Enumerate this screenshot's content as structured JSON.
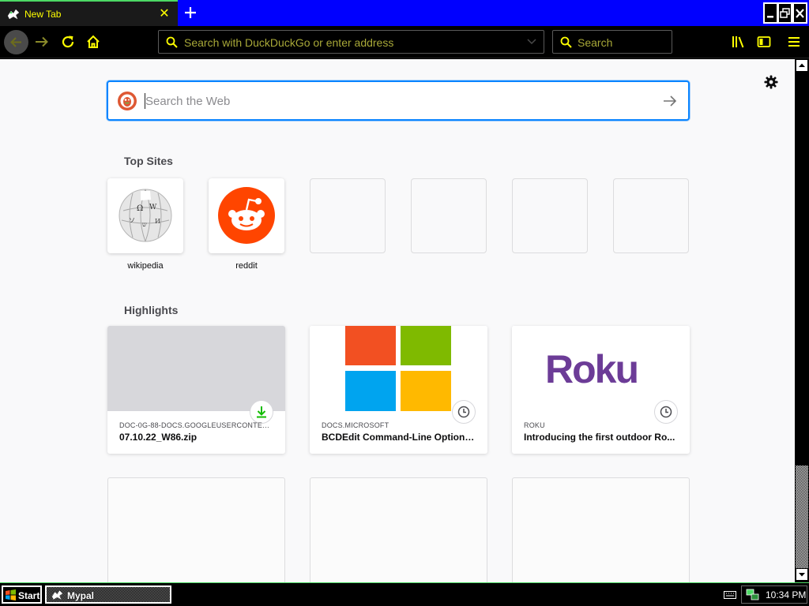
{
  "browser": {
    "tab": {
      "title": "New Tab"
    },
    "urlbar": {
      "placeholder": "Search with DuckDuckGo or enter address"
    },
    "searchbar": {
      "placeholder": "Search"
    }
  },
  "colors": {
    "tab_strip": "#0000ff",
    "accent_text": "#ffff00",
    "focus_ring": "#0a84ff",
    "reddit": "#ff4500",
    "roku": "#6c3c97"
  },
  "icons": [
    "tab-favicon-icon",
    "close-icon",
    "plus-icon",
    "minimize-icon",
    "restore-icon",
    "close-window-icon",
    "back-icon",
    "forward-icon",
    "reload-icon",
    "home-icon",
    "search-icon",
    "chevron-down-icon",
    "library-icon",
    "sidebar-icon",
    "menu-icon",
    "gear-icon",
    "duckduckgo-icon",
    "arrow-right-icon",
    "download-icon",
    "clock-icon"
  ],
  "newtab": {
    "web_search": {
      "placeholder": "Search the Web"
    },
    "top_sites": {
      "title": "Top Sites",
      "sites": [
        {
          "label": "wikipedia"
        },
        {
          "label": "reddit"
        }
      ]
    },
    "highlights": {
      "title": "Highlights",
      "cards": [
        {
          "source": "DOC-0G-88-DOCS.GOOGLEUSERCONTEN...",
          "title": "07.10.22_W86.zip"
        },
        {
          "source": "DOCS.MICROSOFT",
          "title": "BCDEdit Command-Line Options ..."
        },
        {
          "source": "ROKU",
          "title": "Introducing the first outdoor Ro...",
          "logo_text": "Roku"
        }
      ]
    }
  },
  "taskbar": {
    "start_label": "Start",
    "task_label": "Mypal",
    "clock": "10:34 PM"
  }
}
